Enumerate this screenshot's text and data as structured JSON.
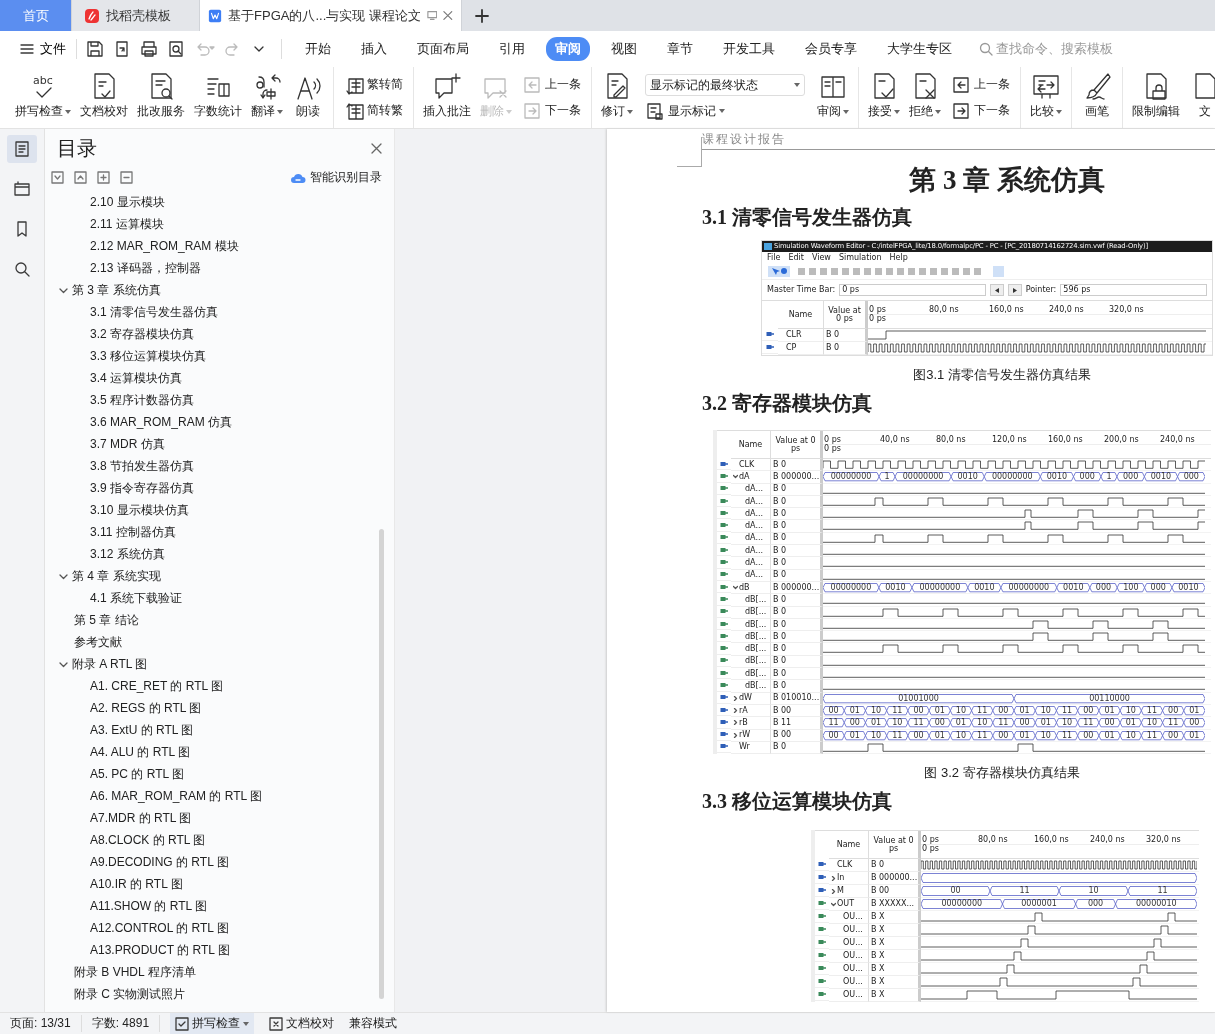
{
  "tabs": [
    {
      "label": "首页",
      "kind": "home",
      "selected": false
    },
    {
      "label": "找稻壳模板",
      "kind": "store",
      "selected": false
    },
    {
      "label": "基于FPGA的八...与实现 课程论文",
      "kind": "doc",
      "selected": true
    }
  ],
  "menu": {
    "file": "文件",
    "quick": [
      {
        "disabled": false
      },
      {
        "disabled": false
      },
      {
        "disabled": false
      },
      {
        "disabled": false
      },
      {
        "disabled": true
      },
      {
        "disabled": true
      },
      {
        "disabled": false
      }
    ],
    "tabs": [
      {
        "label": "开始",
        "selected": false
      },
      {
        "label": "插入",
        "selected": false
      },
      {
        "label": "页面布局",
        "selected": false
      },
      {
        "label": "引用",
        "selected": false
      },
      {
        "label": "审阅",
        "selected": true
      },
      {
        "label": "视图",
        "selected": false
      },
      {
        "label": "章节",
        "selected": false
      },
      {
        "label": "开发工具",
        "selected": false
      },
      {
        "label": "会员专享",
        "selected": false
      },
      {
        "label": "大学生专区",
        "selected": false
      }
    ],
    "search": {
      "placeholder": "查找命令、搜索模板"
    }
  },
  "ribbon": [
    {
      "items": [
        {
          "kind": "big",
          "label": "拼写检查",
          "icon_text": "abc",
          "dropdown": true,
          "disabled": false
        },
        {
          "kind": "big",
          "label": "文档校对",
          "dropdown": false,
          "disabled": false
        },
        {
          "kind": "big",
          "label": "批改服务",
          "dropdown": false,
          "disabled": false
        },
        {
          "kind": "big",
          "label": "字数统计",
          "dropdown": false,
          "disabled": false
        },
        {
          "kind": "big",
          "label": "翻译",
          "dropdown": true,
          "disabled": false
        },
        {
          "kind": "big",
          "label": "朗读",
          "dropdown": false,
          "disabled": false
        }
      ]
    },
    {
      "items": [
        {
          "kind": "stack",
          "rows": [
            {
              "label": "繁转简",
              "disabled": false
            },
            {
              "label": "简转繁",
              "disabled": false
            }
          ]
        }
      ]
    },
    {
      "items": [
        {
          "kind": "big",
          "label": "插入批注",
          "dropdown": false,
          "disabled": false
        },
        {
          "kind": "big",
          "label": "删除",
          "dropdown": true,
          "disabled": true
        },
        {
          "kind": "stack",
          "rows": [
            {
              "label": "上一条",
              "disabled": true
            },
            {
              "label": "下一条",
              "disabled": true
            }
          ]
        }
      ]
    },
    {
      "items": [
        {
          "kind": "big",
          "label": "修订",
          "dropdown": true,
          "disabled": false
        },
        {
          "kind": "select",
          "value": "显示标记的最终状态",
          "row": {
            "label": "显示标记",
            "dropdown": true
          }
        },
        {
          "kind": "big",
          "label": "审阅",
          "dropdown": true,
          "disabled": false
        }
      ]
    },
    {
      "items": [
        {
          "kind": "big",
          "label": "接受",
          "dropdown": true,
          "disabled": false
        },
        {
          "kind": "big",
          "label": "拒绝",
          "dropdown": true,
          "disabled": false
        },
        {
          "kind": "stack",
          "rows": [
            {
              "label": "上一条",
              "disabled": false
            },
            {
              "label": "下一条",
              "disabled": false
            }
          ]
        }
      ]
    },
    {
      "items": [
        {
          "kind": "big",
          "label": "比较",
          "dropdown": true,
          "disabled": false
        }
      ]
    },
    {
      "items": [
        {
          "kind": "big",
          "label": "画笔",
          "dropdown": false,
          "disabled": false
        }
      ]
    },
    {
      "items": [
        {
          "kind": "big",
          "label": "限制编辑",
          "dropdown": false,
          "disabled": false
        },
        {
          "kind": "big",
          "label": "文",
          "dropdown": false,
          "disabled": false
        }
      ]
    }
  ],
  "sidebar": [
    {
      "selected": true
    },
    {
      "selected": false
    },
    {
      "selected": false
    },
    {
      "selected": false
    }
  ],
  "nav": {
    "title": "目录",
    "smart": "智能识别目录",
    "items": [
      {
        "children": [
          {
            "label": "2.10  显示模块"
          },
          {
            "label": "2.11  运算模块"
          },
          {
            "label": "2.12  MAR_ROM_RAM 模块"
          },
          {
            "label": "2.13  译码器，控制器"
          }
        ]
      },
      {
        "label": "第 3 章  系统仿真",
        "expanded": true,
        "children": [
          {
            "label": "3.1  清零信号发生器仿真"
          },
          {
            "label": "3.2  寄存器模块仿真"
          },
          {
            "label": "3.3  移位运算模块仿真"
          },
          {
            "label": "3.4 运算模块仿真"
          },
          {
            "label": "3.5  程序计数器仿真"
          },
          {
            "label": "3.6  MAR_ROM_RAM 仿真"
          },
          {
            "label": "3.7  MDR 仿真"
          },
          {
            "label": "3.8  节拍发生器仿真"
          },
          {
            "label": "3.9  指令寄存器仿真"
          },
          {
            "label": "3.10  显示模块仿真"
          },
          {
            "label": "3.11  控制器仿真"
          },
          {
            "label": "3.12  系统仿真"
          }
        ]
      },
      {
        "label": "第 4 章  系统实现",
        "expanded": true,
        "children": [
          {
            "label": "4.1  系统下载验证"
          }
        ]
      },
      {
        "label": "第 5 章  结论"
      },
      {
        "label": "参考文献"
      },
      {
        "label": "附录 A RTL 图",
        "expanded": true,
        "children": [
          {
            "label": "A1. CRE_RET 的 RTL 图"
          },
          {
            "label": "A2. REGS 的 RTL 图"
          },
          {
            "label": "A3. ExtU 的 RTL 图"
          },
          {
            "label": "A4. ALU 的 RTL 图"
          },
          {
            "label": "A5. PC 的 RTL 图"
          },
          {
            "label": "A6. MAR_ROM_RAM 的 RTL 图"
          },
          {
            "label": "A7.MDR 的 RTL 图"
          },
          {
            "label": "A8.CLOCK 的 RTL 图"
          },
          {
            "label": "A9.DECODING 的 RTL 图"
          },
          {
            "label": "A10.IR 的 RTL 图"
          },
          {
            "label": "A11.SHOW 的 RTL 图"
          },
          {
            "label": "A12.CONTROL 的 RTL 图"
          },
          {
            "label": "A13.PRODUCT 的 RTL 图"
          }
        ]
      },
      {
        "label": "附录 B VHDL 程序清单"
      },
      {
        "label": "附录 C 实物测试照片"
      }
    ]
  },
  "document": {
    "header": "课程设计报告",
    "blocks": [
      {
        "kind": "chapter",
        "text": "第 3 章  系统仿真"
      },
      {
        "kind": "section",
        "text": "3.1  清零信号发生器仿真"
      },
      {
        "kind": "figure",
        "title": "Simulation Waveform Editor - C:/intelFPGA_lite/18.0/formalpc/PC - PC - [PC_20180714162724.sim.vwf (Read-Only)]",
        "menu": [
          "File",
          "Edit",
          "View",
          "Simulation",
          "Help"
        ],
        "master_label": "Master Time Bar:",
        "master_value": "0 ps",
        "pointer_label": "Pointer:",
        "pointer_value": "596 ps",
        "name_header": "Name",
        "value_header": "Value at 0 ps",
        "ticks": [
          "0 ps",
          "80,0 ns",
          "160,0 ns",
          "240,0 ns",
          "320,0 ns"
        ],
        "cursor": "0 ps",
        "signals": [
          {
            "name": "CLR",
            "value": "B 0",
            "kind": "step"
          },
          {
            "name": "CP",
            "value": "B 0",
            "kind": "clock"
          }
        ]
      },
      {
        "kind": "caption",
        "text": "图3.1 清零信号发生器仿真结果"
      },
      {
        "kind": "section",
        "text": "3.2  寄存器模块仿真"
      },
      {
        "kind": "figure",
        "name_header": "Name",
        "value_header": "Value at 0 ps",
        "ticks": [
          "0 ps",
          "40,0 ns",
          "80,0 ns",
          "120,0 ns",
          "160,0 ns",
          "200,0 ns",
          "240,0 ns"
        ],
        "cursor": "0 ps",
        "signals": [
          {
            "name": "CLK",
            "value": "B 0",
            "kind": "clock"
          },
          {
            "name": "dA",
            "value": "B 000000...",
            "expanded": true,
            "kind": "bus",
            "segments": [
              "00000000",
              "1",
              "00000000",
              "0010",
              "00000000",
              "0010",
              "000",
              "1",
              "000",
              "0010",
              "000"
            ],
            "children": [
              {
                "name": "dA...",
                "value": "B 0",
                "kind": "flat"
              },
              {
                "name": "dA...",
                "value": "B 0",
                "kind": "pulse_a"
              },
              {
                "name": "dA...",
                "value": "B 0",
                "kind": "pulse_b"
              },
              {
                "name": "dA...",
                "value": "B 0",
                "kind": "pulse_b"
              },
              {
                "name": "dA...",
                "value": "B 0",
                "kind": "pulse_a"
              },
              {
                "name": "dA...",
                "value": "B 0",
                "kind": "flat"
              },
              {
                "name": "dA...",
                "value": "B 0",
                "kind": "flat"
              },
              {
                "name": "dA...",
                "value": "B 0",
                "kind": "flat"
              }
            ]
          },
          {
            "name": "dB",
            "value": "B 000000...",
            "expanded": true,
            "kind": "bus",
            "segments": [
              "00000000",
              "0010",
              "00000000",
              "0010",
              "00000000",
              "0010",
              "000",
              "100",
              "000",
              "0010"
            ],
            "children": [
              {
                "name": "dB[...",
                "value": "B 0",
                "kind": "flat"
              },
              {
                "name": "dB[...",
                "value": "B 0",
                "kind": "pulse_c"
              },
              {
                "name": "dB[...",
                "value": "B 0",
                "kind": "pulse_d"
              },
              {
                "name": "dB[...",
                "value": "B 0",
                "kind": "pulse_d"
              },
              {
                "name": "dB[...",
                "value": "B 0",
                "kind": "pulse_c"
              },
              {
                "name": "dB[...",
                "value": "B 0",
                "kind": "flat"
              },
              {
                "name": "dB[...",
                "value": "B 0",
                "kind": "flat"
              },
              {
                "name": "dB[...",
                "value": "B 0",
                "kind": "flat"
              }
            ]
          },
          {
            "name": "dW",
            "value": "B 010010...",
            "expanded": false,
            "kind": "bus",
            "segments": [
              "01001000",
              "00110000"
            ]
          },
          {
            "name": "rA",
            "value": "B 00",
            "expanded": false,
            "kind": "bus",
            "segments": [
              "00",
              "01",
              "10",
              "11",
              "00",
              "01",
              "10",
              "11",
              "00",
              "01",
              "10",
              "11",
              "00",
              "01",
              "10",
              "11",
              "00",
              "01"
            ]
          },
          {
            "name": "rB",
            "value": "B 11",
            "expanded": false,
            "kind": "bus",
            "segments": [
              "11",
              "00",
              "01",
              "10",
              "11",
              "00",
              "01",
              "10",
              "11",
              "00",
              "01",
              "10",
              "11",
              "00",
              "01",
              "10",
              "11",
              "00"
            ]
          },
          {
            "name": "rW",
            "value": "B 00",
            "expanded": false,
            "kind": "bus",
            "segments": [
              "00",
              "01",
              "10",
              "11",
              "00",
              "01",
              "10",
              "11",
              "00",
              "01",
              "10",
              "11",
              "00",
              "01",
              "10",
              "11",
              "00",
              "01"
            ]
          },
          {
            "name": "Wr",
            "value": "B 0",
            "kind": "strobe"
          }
        ]
      },
      {
        "kind": "caption",
        "text": "图 3.2 寄存器模块仿真结果"
      },
      {
        "kind": "section",
        "text": "3.3  移位运算模块仿真"
      },
      {
        "kind": "figure",
        "name_header": "Name",
        "value_header": "Value at 0 ps",
        "ticks": [
          "0 ps",
          "80,0 ns",
          "160,0 ns",
          "240,0 ns",
          "320,0 ns"
        ],
        "cursor": "0 ps",
        "signals": [
          {
            "name": "CLK",
            "value": "B 0",
            "kind": "clock"
          },
          {
            "name": "In",
            "value": "B 000000...",
            "expanded": false,
            "kind": "bus"
          },
          {
            "name": "M",
            "value": "B 00",
            "expanded": false,
            "kind": "bus",
            "segments": [
              "00",
              "11",
              "10",
              "11"
            ]
          },
          {
            "name": "OUT",
            "value": "B XXXXX...",
            "expanded": true,
            "kind": "bus",
            "segments": [
              "00000000",
              "0000001",
              "000",
              "00000010"
            ],
            "children": [
              {
                "name": "OU...",
                "value": "B X",
                "kind": "step1"
              },
              {
                "name": "OU...",
                "value": "B X",
                "kind": "step2"
              },
              {
                "name": "OU...",
                "value": "B X",
                "kind": "step3"
              },
              {
                "name": "OU...",
                "value": "B X",
                "kind": "step4"
              },
              {
                "name": "OU...",
                "value": "B X",
                "kind": "step5"
              },
              {
                "name": "OU...",
                "value": "B X",
                "kind": "step6"
              },
              {
                "name": "OU...",
                "value": "B X",
                "kind": "step7"
              }
            ]
          }
        ]
      }
    ]
  },
  "status": [
    {
      "kind": "text",
      "label": "页面: 13/31"
    },
    {
      "kind": "text",
      "label": "字数: 4891"
    },
    {
      "kind": "button",
      "label": "拼写检查",
      "dropdown": true,
      "selected": true
    },
    {
      "kind": "button",
      "label": "文档校对",
      "dropdown": false,
      "selected": false
    },
    {
      "kind": "text",
      "label": "兼容模式"
    }
  ]
}
